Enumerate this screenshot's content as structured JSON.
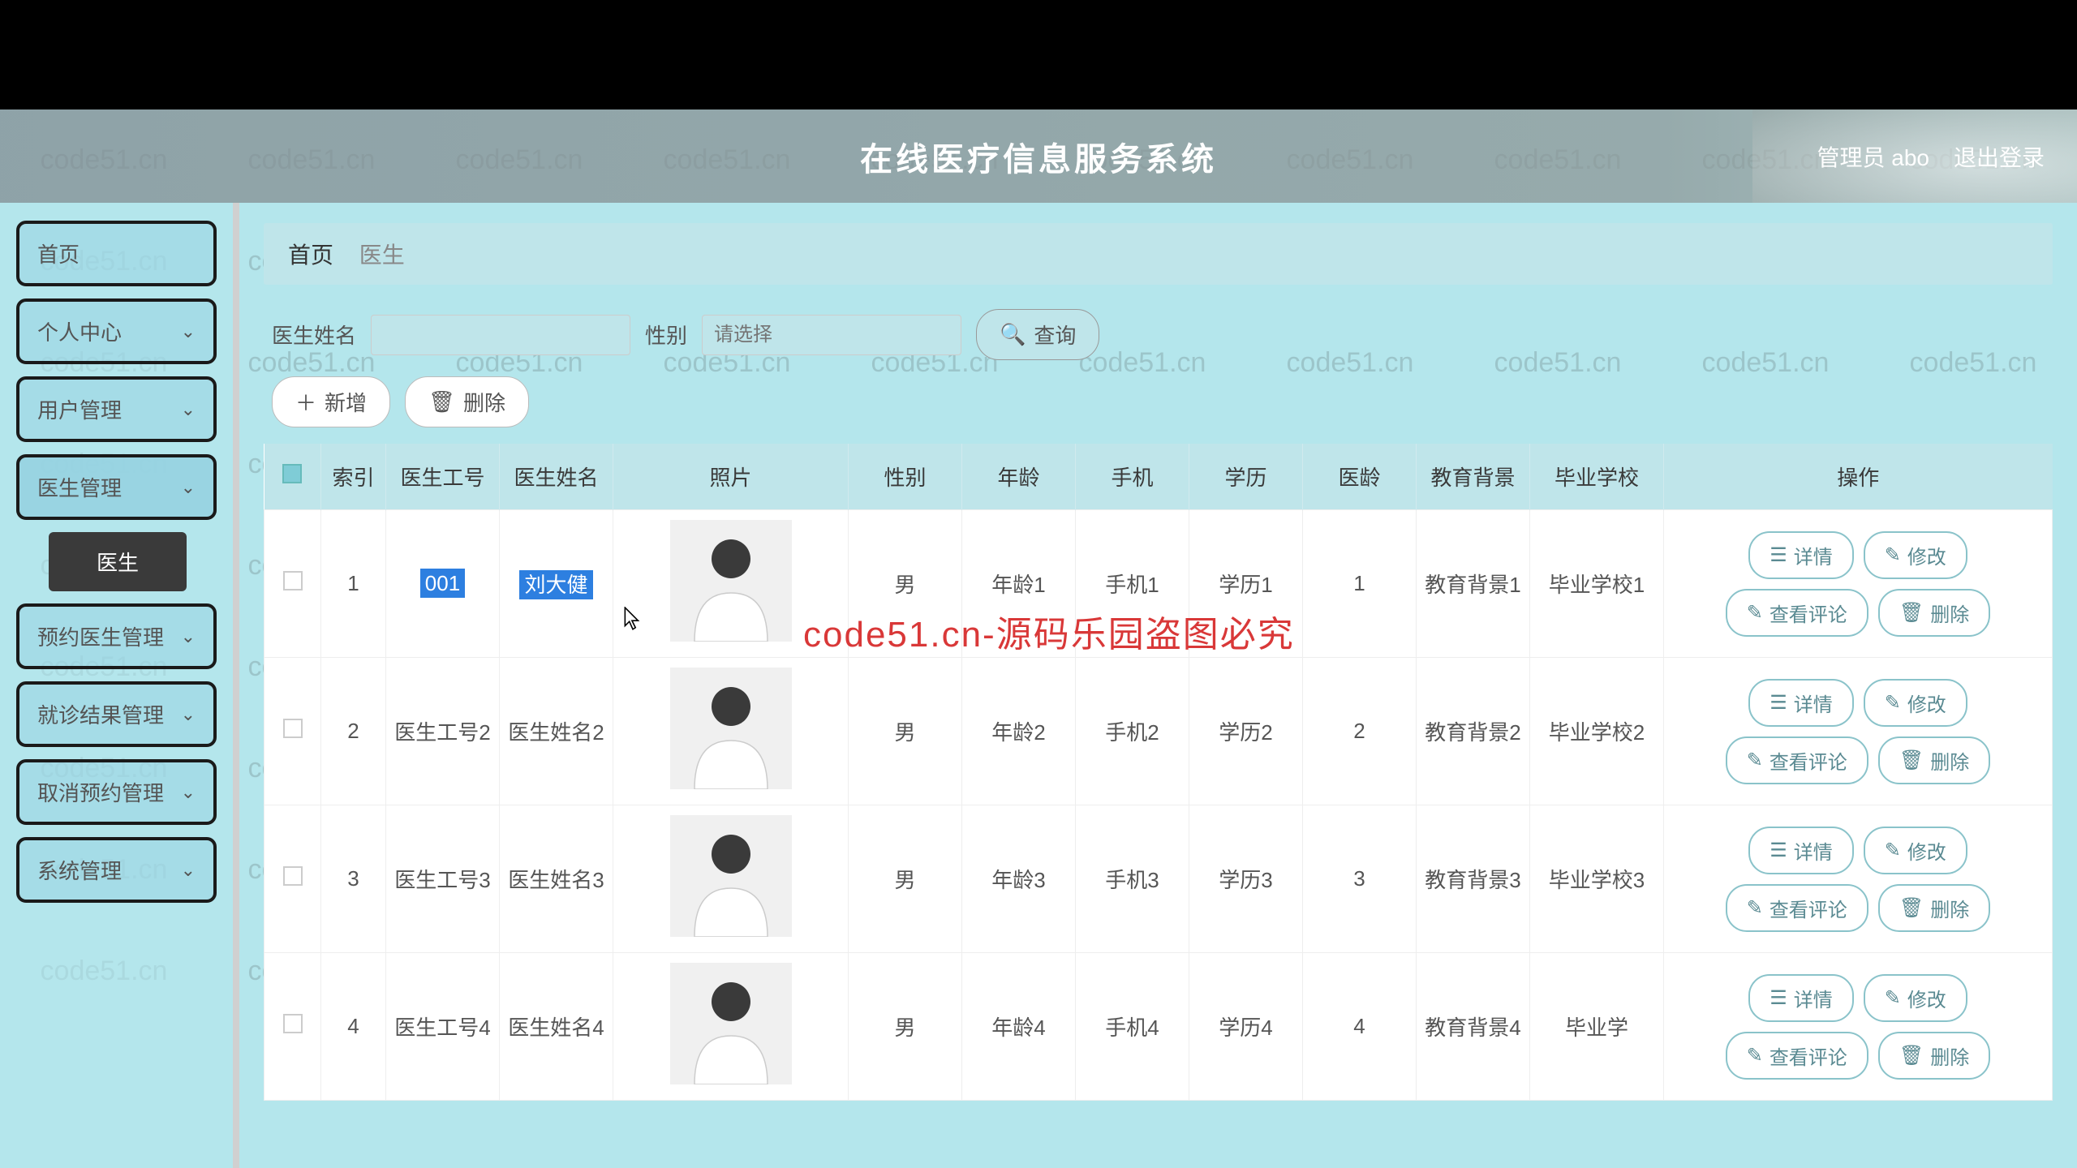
{
  "header": {
    "title": "在线医疗信息服务系统",
    "user": "管理员 abo",
    "logout": "退出登录"
  },
  "sidebar": {
    "items": [
      {
        "label": "首页"
      },
      {
        "label": "个人中心"
      },
      {
        "label": "用户管理"
      },
      {
        "label": "医生管理",
        "active": true
      },
      {
        "label": "预约医生管理"
      },
      {
        "label": "就诊结果管理"
      },
      {
        "label": "取消预约管理"
      },
      {
        "label": "系统管理"
      }
    ],
    "sub": {
      "label": "医生"
    }
  },
  "breadcrumb": {
    "home": "首页",
    "current": "医生"
  },
  "search": {
    "name_label": "医生姓名",
    "gender_label": "性别",
    "query": "查询",
    "sel_placeholder": "请选择"
  },
  "actions": {
    "add": "新增",
    "delete": "删除"
  },
  "table": {
    "headers": {
      "idx": "索引",
      "id": "医生工号",
      "name": "医生姓名",
      "photo": "照片",
      "gender": "性别",
      "age": "年龄",
      "phone": "手机",
      "edu": "学历",
      "med": "医龄",
      "bg": "教育背景",
      "school": "毕业学校",
      "ops": "操作"
    },
    "rows": [
      {
        "idx": "1",
        "id": "001",
        "name": "刘大健",
        "gender": "男",
        "age": "年龄1",
        "phone": "手机1",
        "edu": "学历1",
        "med": "1",
        "bg": "教育背景1",
        "school": "毕业学校1",
        "hl": true
      },
      {
        "idx": "2",
        "id": "医生工号2",
        "name": "医生姓名2",
        "gender": "男",
        "age": "年龄2",
        "phone": "手机2",
        "edu": "学历2",
        "med": "2",
        "bg": "教育背景2",
        "school": "毕业学校2"
      },
      {
        "idx": "3",
        "id": "医生工号3",
        "name": "医生姓名3",
        "gender": "男",
        "age": "年龄3",
        "phone": "手机3",
        "edu": "学历3",
        "med": "3",
        "bg": "教育背景3",
        "school": "毕业学校3"
      },
      {
        "idx": "4",
        "id": "医生工号4",
        "name": "医生姓名4",
        "gender": "男",
        "age": "年龄4",
        "phone": "手机4",
        "edu": "学历4",
        "med": "4",
        "bg": "教育背景4",
        "school": "毕业学"
      }
    ],
    "ops": {
      "detail": "详情",
      "edit": "修改",
      "comment": "查看评论",
      "del": "删除"
    }
  },
  "watermark": "code51.cn",
  "overlay": "code51.cn-源码乐园盗图必究"
}
